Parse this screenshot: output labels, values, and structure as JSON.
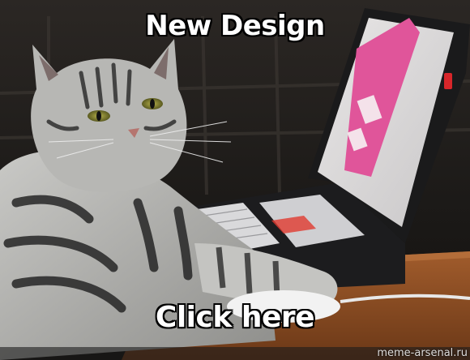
{
  "meme": {
    "top_text": "New Design",
    "bottom_text": "Click here",
    "watermark": "meme-arsenal.ru"
  },
  "colors": {
    "caption_fill": "#ffffff",
    "caption_outline": "#000000",
    "laptop_screen_accent": "#e0559a",
    "mouse_led": "#e03a2f"
  },
  "icons": {
    "cat": "cat-illustration",
    "laptop": "laptop-illustration",
    "mouse": "computer-mouse-illustration"
  }
}
